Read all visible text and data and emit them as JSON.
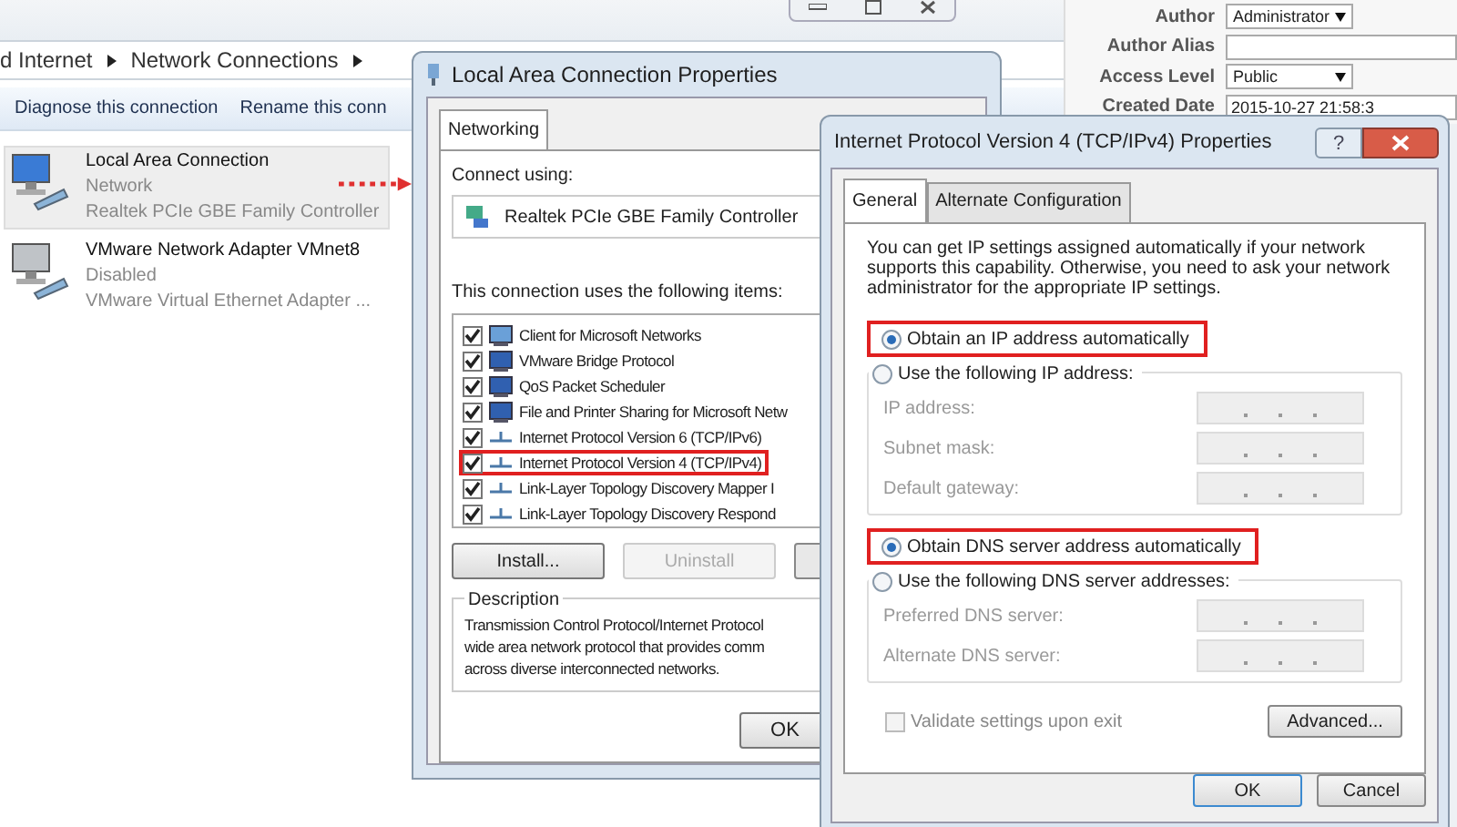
{
  "explorer": {
    "breadcrumb": [
      "d Internet",
      "Network Connections"
    ],
    "toolbar": [
      "Diagnose this connection",
      "Rename this conn"
    ],
    "connections": [
      {
        "name": "Local Area Connection",
        "status": "Network",
        "adapter": "Realtek PCIe GBE Family Controller",
        "selected": true,
        "disabled": false
      },
      {
        "name": "VMware Network Adapter VMnet8",
        "status": "Disabled",
        "adapter": "VMware Virtual Ethernet Adapter ...",
        "selected": false,
        "disabled": true
      }
    ]
  },
  "web_form": {
    "fields": [
      {
        "label": "Author",
        "value": "Administrator",
        "kind": "select"
      },
      {
        "label": "Author Alias",
        "kind": "text"
      },
      {
        "label": "Access Level",
        "value": "Public",
        "kind": "select"
      },
      {
        "label": "Created Date",
        "value": "2015-10-27 21:58:3",
        "kind": "text"
      }
    ]
  },
  "lan_dialog": {
    "title": "Local Area Connection Properties",
    "tabs": [
      {
        "label": "Networking",
        "selected": true
      }
    ],
    "connect_using_label": "Connect using:",
    "adapter": "Realtek PCIe GBE Family Controller",
    "items_label": "This connection uses the following items:",
    "items": [
      {
        "label": "Client for Microsoft Networks",
        "checked": true,
        "highlighted": false,
        "kind": "client"
      },
      {
        "label": "VMware Bridge Protocol",
        "checked": true,
        "highlighted": false,
        "kind": "service"
      },
      {
        "label": "QoS Packet Scheduler",
        "checked": true,
        "highlighted": false,
        "kind": "service"
      },
      {
        "label": "File and Printer Sharing for Microsoft Netw",
        "checked": true,
        "highlighted": false,
        "kind": "service"
      },
      {
        "label": "Internet Protocol Version 6 (TCP/IPv6)",
        "checked": true,
        "highlighted": false,
        "kind": "protocol"
      },
      {
        "label": "Internet Protocol Version 4 (TCP/IPv4)",
        "checked": true,
        "highlighted": true,
        "kind": "protocol"
      },
      {
        "label": "Link-Layer Topology Discovery Mapper I",
        "checked": true,
        "highlighted": false,
        "kind": "protocol"
      },
      {
        "label": "Link-Layer Topology Discovery Respond",
        "checked": true,
        "highlighted": false,
        "kind": "protocol"
      }
    ],
    "buttons": [
      {
        "label": "Install...",
        "disabled": false
      },
      {
        "label": "Uninstall",
        "disabled": true
      }
    ],
    "description_label": "Description",
    "description_lines": [
      "Transmission Control Protocol/Internet Protocol",
      "wide area network protocol that provides comm",
      "across diverse interconnected networks."
    ],
    "ok": "OK"
  },
  "ipv4_dialog": {
    "title": "Internet Protocol Version 4 (TCP/IPv4) Properties",
    "help": "?",
    "tabs": [
      {
        "label": "General",
        "selected": true
      },
      {
        "label": "Alternate Configuration",
        "selected": false
      }
    ],
    "intro": "You can get IP settings assigned automatically if your network supports this capability. Otherwise, you need to ask your network administrator for the appropriate IP settings.",
    "ip_options": [
      {
        "label": "Obtain an IP address automatically",
        "selected": true,
        "highlighted": true
      },
      {
        "label": "Use the following IP address:",
        "selected": false,
        "highlighted": false
      }
    ],
    "ip_fields": [
      {
        "label": "IP address:"
      },
      {
        "label": "Subnet mask:"
      },
      {
        "label": "Default gateway:"
      }
    ],
    "dns_options": [
      {
        "label": "Obtain DNS server address automatically",
        "selected": true,
        "highlighted": true
      },
      {
        "label": "Use the following DNS server addresses:",
        "selected": false,
        "highlighted": false
      }
    ],
    "dns_fields": [
      {
        "label": "Preferred DNS server:"
      },
      {
        "label": "Alternate DNS server:"
      }
    ],
    "validate": {
      "label": "Validate settings upon exit",
      "checked": false
    },
    "advanced": "Advanced...",
    "ok": "OK",
    "cancel": "Cancel"
  }
}
